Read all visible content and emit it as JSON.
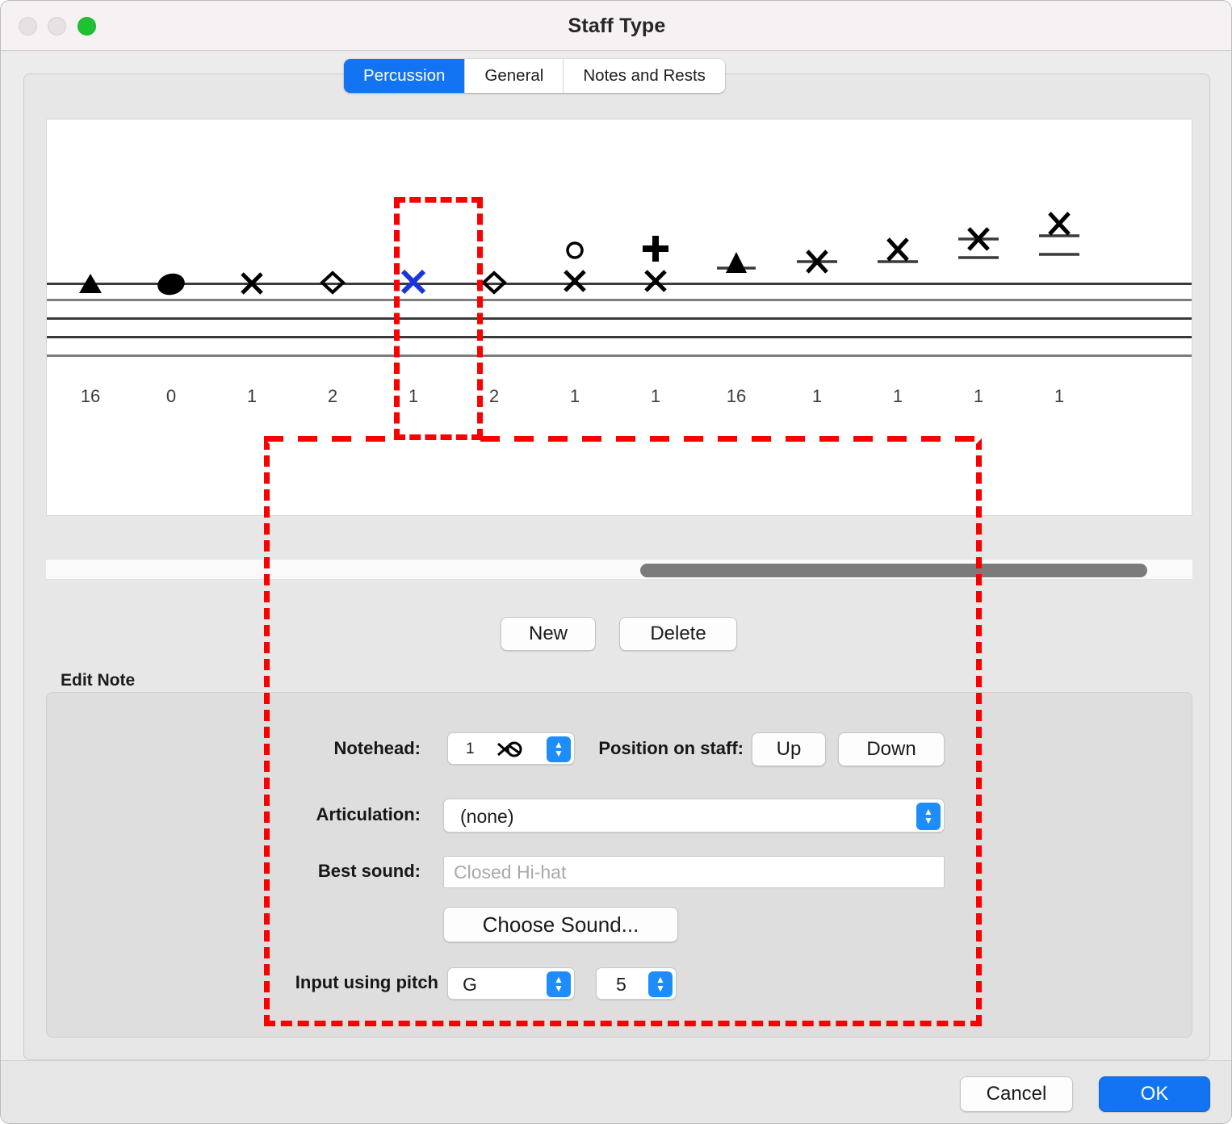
{
  "window": {
    "title": "Staff Type",
    "traffic_lights": [
      "close-button",
      "minimize-button",
      "zoom-button"
    ]
  },
  "tabs": [
    {
      "label": "Percussion",
      "active": true
    },
    {
      "label": "General",
      "active": false
    },
    {
      "label": "Notes and Rests",
      "active": false
    }
  ],
  "staff": {
    "columns": [
      {
        "number": "16",
        "glyph": "filled-triangle",
        "position": "space-below-top-line"
      },
      {
        "number": "0",
        "glyph": "filled-oval",
        "position": "on-top-line"
      },
      {
        "number": "1",
        "glyph": "x-notehead",
        "position": "on-top-line"
      },
      {
        "number": "2",
        "glyph": "diamond-notehead",
        "position": "on-top-line"
      },
      {
        "number": "1",
        "glyph": "x-notehead",
        "position": "on-top-line",
        "selected": true,
        "color": "#1a36d8"
      },
      {
        "number": "2",
        "glyph": "diamond-notehead",
        "position": "on-top-line"
      },
      {
        "number": "1",
        "glyph": "x-notehead-with-circle",
        "position": "on-top-line"
      },
      {
        "number": "1",
        "glyph": "x-notehead-with-plus",
        "position": "on-top-line"
      },
      {
        "number": "16",
        "glyph": "filled-triangle-ledger",
        "position": "one-ledger-above"
      },
      {
        "number": "1",
        "glyph": "x-notehead-ledger",
        "position": "one-ledger-above"
      },
      {
        "number": "1",
        "glyph": "x-notehead-ledger",
        "position": "one-ledger-above-high"
      },
      {
        "number": "1",
        "glyph": "x-notehead-two-ledgers",
        "position": "two-ledgers-above"
      },
      {
        "number": "1",
        "glyph": "x-notehead-two-ledgers",
        "position": "two-ledgers-above-high"
      }
    ]
  },
  "scrollbar": {
    "name": "horizontal-scrollbar",
    "orientation": "horizontal"
  },
  "buttons": {
    "new_label": "New",
    "delete_label": "Delete"
  },
  "edit_note": {
    "group_label": "Edit Note",
    "notehead_label": "Notehead:",
    "notehead_value": "1",
    "notehead_glyph": "x-and-circle-notehead",
    "position_label": "Position on staff:",
    "up_label": "Up",
    "down_label": "Down",
    "articulation_label": "Articulation:",
    "articulation_value": "(none)",
    "best_sound_label": "Best sound:",
    "best_sound_placeholder": "Closed Hi-hat",
    "choose_sound_label": "Choose Sound...",
    "input_pitch_label": "Input using pitch",
    "pitch_note": "G",
    "pitch_octave": "5"
  },
  "footer": {
    "cancel_label": "Cancel",
    "ok_label": "OK"
  },
  "colors": {
    "accent_blue": "#1274f3",
    "selected_note_blue": "#1a36d8",
    "annotation_red": "#fb0000",
    "window_bg": "#e7e7e7"
  }
}
